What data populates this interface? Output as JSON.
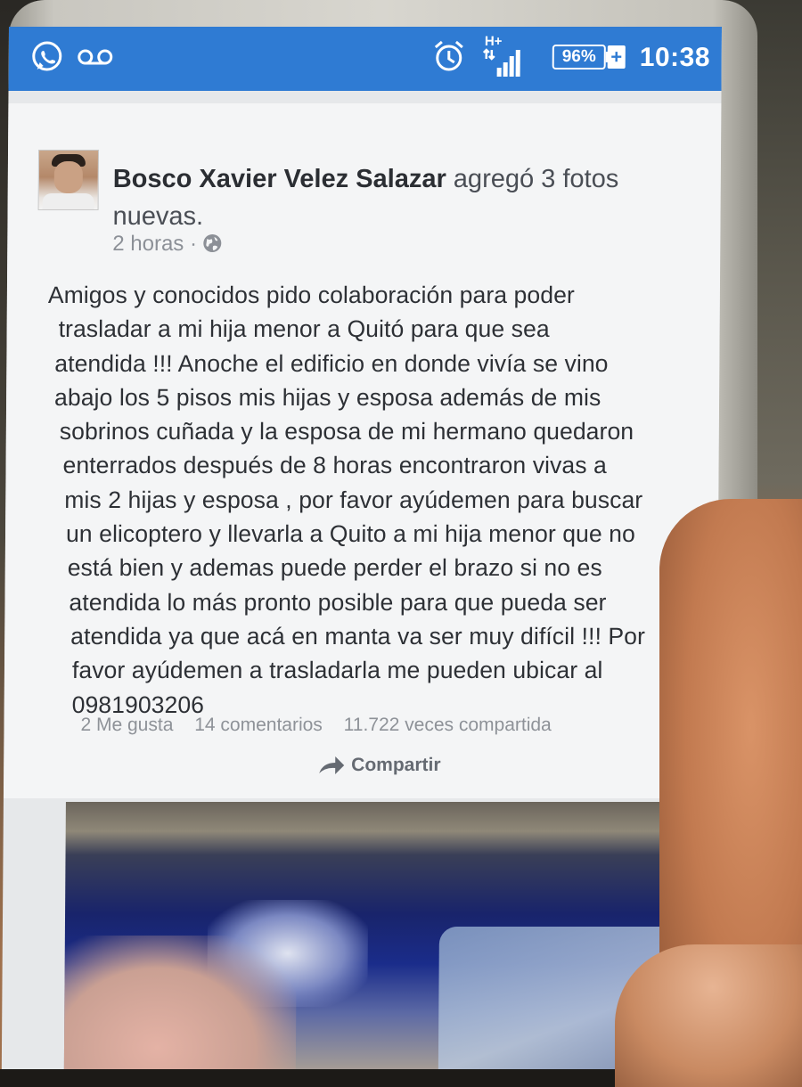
{
  "status_bar": {
    "battery": "96%",
    "network": "H+",
    "time": "10:38",
    "icons": [
      "whatsapp-icon",
      "voicemail-icon",
      "alarm-icon",
      "signal-icon",
      "battery-icon",
      "charging-icon"
    ],
    "background_color": "#2f7bd3"
  },
  "post": {
    "author": "Bosco Xavier Velez Salazar",
    "action": "agregó 3 fotos nuevas.",
    "time_ago": "2 horas",
    "separator": "·",
    "privacy_icon": "globe-icon",
    "body_lines": [
      "Amigos y conocidos pido colaboración para poder",
      "trasladar a  mi hija menor a Quitó para que sea",
      "atendida !!! Anoche el edificio en donde vivía se vino",
      "abajo los 5 pisos mis hijas y esposa además de mis",
      "sobrinos cuñada y la esposa de mi hermano quedaron",
      "enterrados después de 8 horas encontraron vivas a",
      "mis 2 hijas y esposa , por favor ayúdemen para buscar",
      "un elicoptero y llevarla a Quito a mi hija menor que no",
      "está bien y ademas puede perder el brazo si no es",
      "atendida lo más pronto posible para que pueda ser",
      "atendida ya que acá en manta va ser muy difícil !!! Por",
      "favor ayúdemen a trasladarla me pueden ubicar al",
      "0981903206"
    ],
    "likes": "2 Me gusta",
    "comments": "14 comentarios",
    "shares": "11.722 veces compartida",
    "share_button": "Compartir",
    "accent_color": "#3b5998"
  }
}
